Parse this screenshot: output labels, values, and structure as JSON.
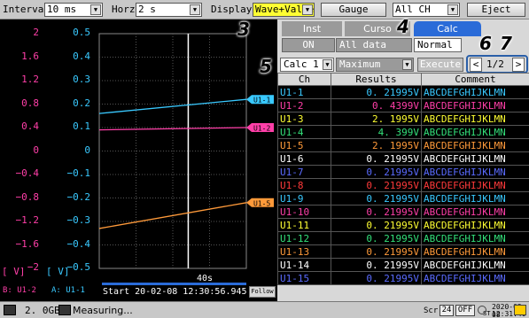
{
  "toolbar": {
    "interval_label": "Interval",
    "interval_value": "10 ms",
    "horz_label": "Horz",
    "horz_value": "2 s",
    "display_label": "Display",
    "display_value": "Wave+Value",
    "gauge_label": "Gauge",
    "channel_value": "All CH",
    "eject_label": "Eject"
  },
  "callouts": [
    "3",
    "4",
    "5",
    "6",
    "7"
  ],
  "graph": {
    "axis_b": [
      "2",
      "1.6",
      "1.2",
      "0.8",
      "0.4",
      "0",
      "−0.4",
      "−0.8",
      "−1.2",
      "−1.6",
      "−2"
    ],
    "axis_a": [
      "0.5",
      "0.4",
      "0.3",
      "0.2",
      "0.1",
      "0",
      "−0.1",
      "−0.2",
      "−0.3",
      "−0.4",
      "−0.5"
    ],
    "unit_b": "[    V]",
    "unit_a": "[    V]",
    "ch_b": "B:  U1-2",
    "ch_a": "A:  U1-1",
    "start_text": "Start 20-02-08 12:30:56.945",
    "time_div": "40s",
    "follow_label": "Follow",
    "traces": [
      {
        "label": "U1-1",
        "color": "#39c9ff",
        "tag_color": "#39c9ff",
        "start_value": 0.16,
        "end_value": 0.22
      },
      {
        "label": "U1-2",
        "color": "#ff3fa8",
        "tag_color": "#ff3fa8",
        "start_value": 0.09,
        "end_value": 0.1
      },
      {
        "label": "U1-5",
        "color": "#ff9a3a",
        "tag_color": "#ff9a3a",
        "start_value": -0.33,
        "end_value": -0.22
      }
    ]
  },
  "panel": {
    "tabs": [
      "Inst",
      "Curso",
      "Calc"
    ],
    "on_label": "ON",
    "data_value": "All data",
    "normal_value": "Normal",
    "calc_select": "Calc 1",
    "calc_func": "Maximum",
    "execute_label": "Execute",
    "prev_label": "<",
    "page_label": "1/2",
    "next_label": ">",
    "table": {
      "headers": [
        "Ch",
        "Results",
        "Comment"
      ],
      "rows": [
        {
          "ch": "U1-1",
          "result": "0. 21995V",
          "comment": "ABCDEFGHIJKLMN",
          "color": "#39c9ff"
        },
        {
          "ch": "U1-2",
          "result": "0. 4399V",
          "comment": "ABCDEFGHIJKLMN",
          "color": "#ff3fa8"
        },
        {
          "ch": "U1-3",
          "result": "2. 1995V",
          "comment": "ABCDEFGHIJKLMN",
          "color": "#ffff33"
        },
        {
          "ch": "U1-4",
          "result": "4. 399V",
          "comment": "ABCDEFGHIJKLMN",
          "color": "#33e07a"
        },
        {
          "ch": "U1-5",
          "result": "2. 1995V",
          "comment": "ABCDEFGHIJKLMN",
          "color": "#ff9a3a"
        },
        {
          "ch": "U1-6",
          "result": "0. 21995V",
          "comment": "ABCDEFGHIJKLMN",
          "color": "#ffffff"
        },
        {
          "ch": "U1-7",
          "result": "0. 21995V",
          "comment": "ABCDEFGHIJKLMN",
          "color": "#5a6bff"
        },
        {
          "ch": "U1-8",
          "result": "0. 21995V",
          "comment": "ABCDEFGHIJKLMN",
          "color": "#ff3a3a"
        },
        {
          "ch": "U1-9",
          "result": "0. 21995V",
          "comment": "ABCDEFGHIJKLMN",
          "color": "#39c9ff"
        },
        {
          "ch": "U1-10",
          "result": "0. 21995V",
          "comment": "ABCDEFGHIJKLMN",
          "color": "#ff3fa8"
        },
        {
          "ch": "U1-11",
          "result": "0. 21995V",
          "comment": "ABCDEFGHIJKLMN",
          "color": "#ffff33"
        },
        {
          "ch": "U1-12",
          "result": "0. 21995V",
          "comment": "ABCDEFGHIJKLMN",
          "color": "#33e07a"
        },
        {
          "ch": "U1-13",
          "result": "0. 21995V",
          "comment": "ABCDEFGHIJKLMN",
          "color": "#ff9a3a"
        },
        {
          "ch": "U1-14",
          "result": "0. 21995V",
          "comment": "ABCDEFGHIJKLMN",
          "color": "#ffffff"
        },
        {
          "ch": "U1-15",
          "result": "0. 21995V",
          "comment": "ABCDEFGHIJKLMN",
          "color": "#5a6bff"
        }
      ]
    }
  },
  "status": {
    "storage": "2. 0GB",
    "state": "Measuring...",
    "scr_label": "Scr",
    "num_24": "24",
    "off_label": "OFF",
    "date": "2020-02-08",
    "time": "12:31:40",
    "st_label": "ST"
  }
}
